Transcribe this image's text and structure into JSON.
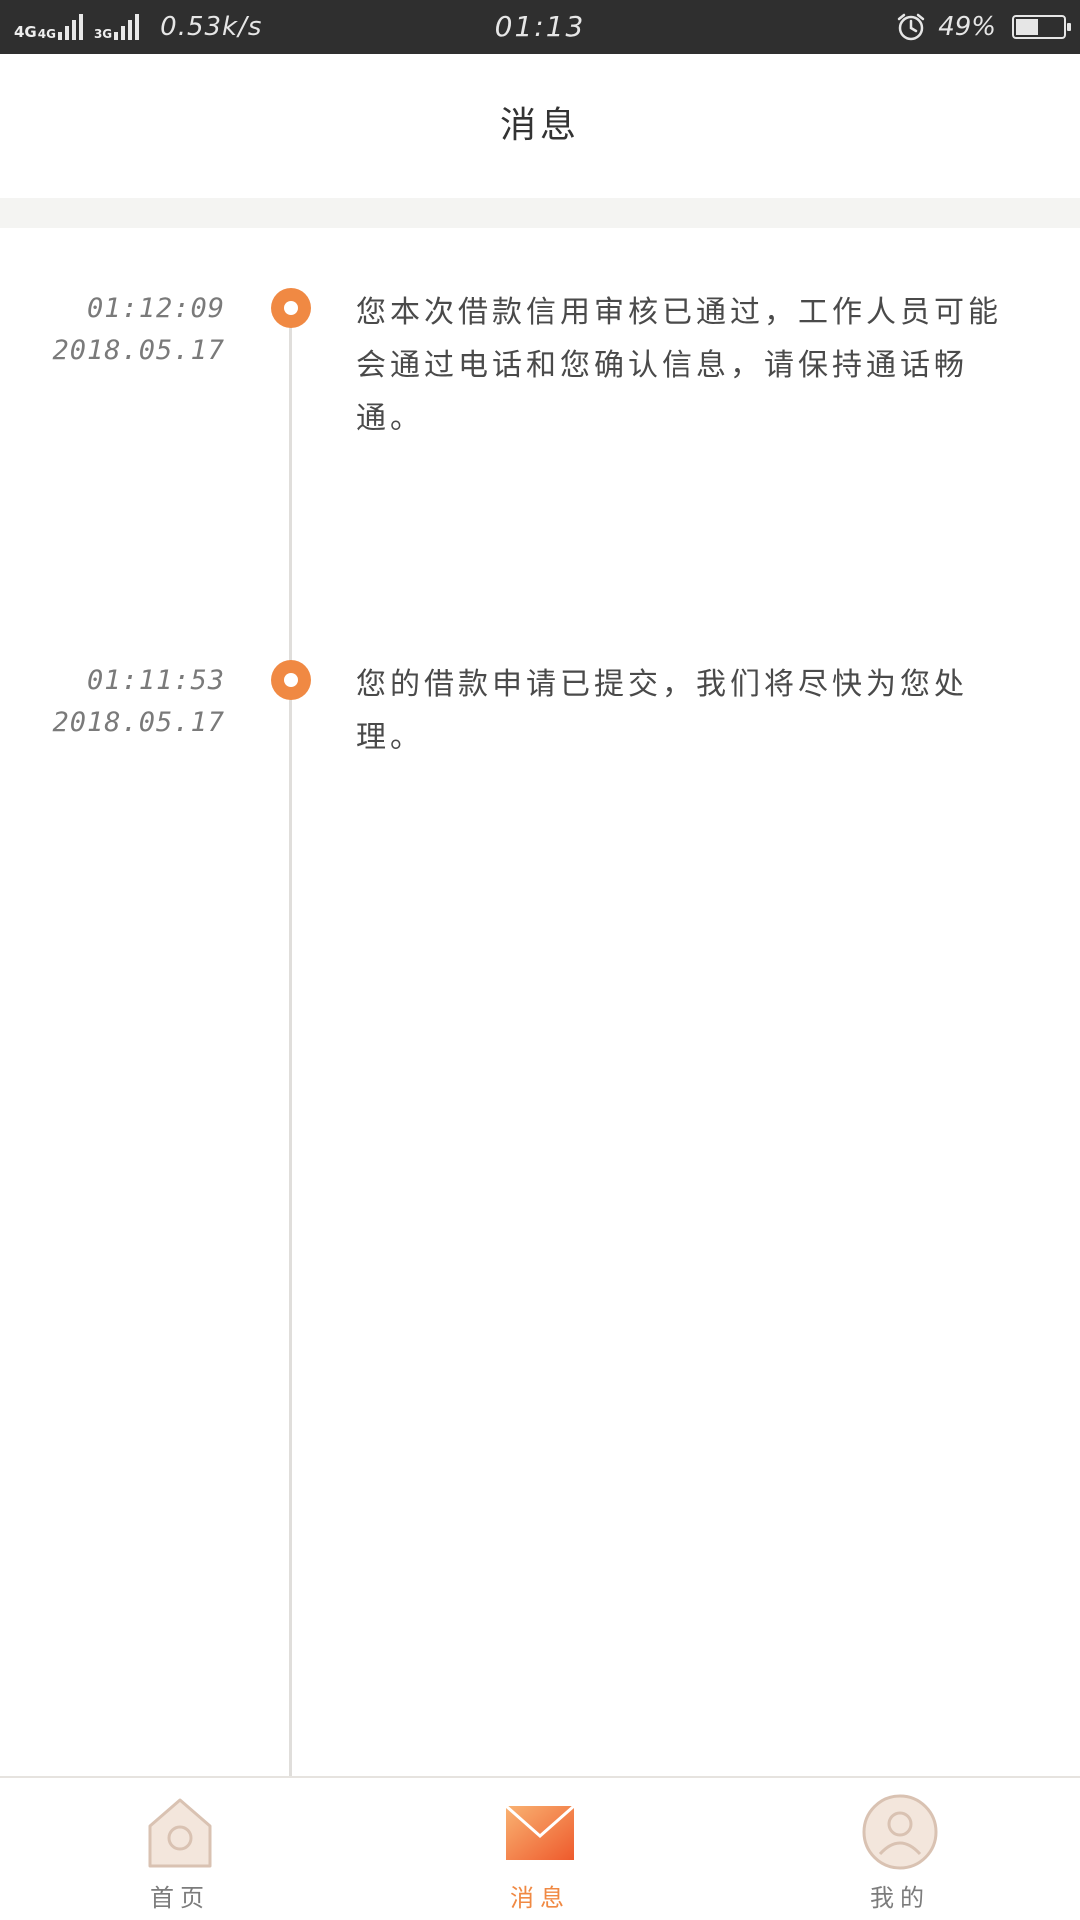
{
  "status_bar": {
    "net1": "4G",
    "net2": "4G",
    "net3": "3G",
    "speed": "0.53k/s",
    "time": "01:13",
    "battery": "49%",
    "battery_level": 0.49,
    "icons": [
      "signal-icon",
      "alarm-icon",
      "battery-icon"
    ]
  },
  "header": {
    "title": "消息"
  },
  "messages": [
    {
      "time": "01:12:09",
      "date": "2018.05.17",
      "text": "您本次借款信用审核已通过，工作人员可能会通过电话和您确认信息，请保持通话畅通。"
    },
    {
      "time": "01:11:53",
      "date": "2018.05.17",
      "text": "您的借款申请已提交，我们将尽快为您处理。"
    }
  ],
  "bottom_nav": {
    "items": [
      {
        "label": "首页",
        "icon": "home-icon",
        "active": false
      },
      {
        "label": "消息",
        "icon": "message-envelope-icon",
        "active": true
      },
      {
        "label": "我的",
        "icon": "profile-icon",
        "active": false
      }
    ]
  },
  "colors": {
    "accent": "#f08943",
    "status_bar_bg": "#2f2f2f",
    "timeline_line": "#e0dedb",
    "inactive_icon": "#ead9cc"
  }
}
